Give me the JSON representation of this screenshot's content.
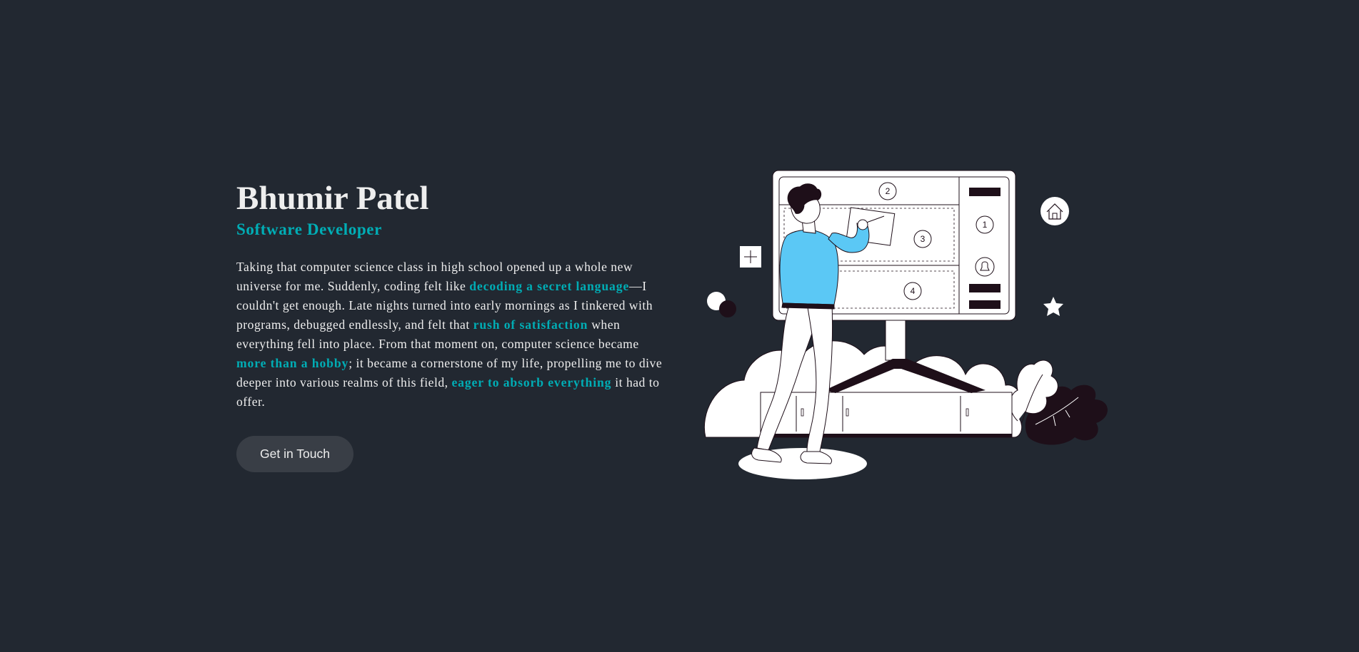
{
  "profile": {
    "name": "Bhumir Patel",
    "role": "Software Developer"
  },
  "bio": {
    "p1": "Taking that computer science class in high school opened up a whole new universe for me. Suddenly, coding felt like ",
    "h1": "decoding a secret language",
    "p2": "—I couldn't get enough. Late nights turned into early mornings as I tinkered with programs, debugged endlessly, and felt that ",
    "h2": "rush of satisfaction",
    "p3": " when everything fell into place. From that moment on, computer science became ",
    "h3": "more than a hobby",
    "p4": "; it became a cornerstone of my life, propelling me to dive deeper into various realms of this field, ",
    "h4": "eager to absorb everything",
    "p5": " it had to offer."
  },
  "cta": {
    "label": "Get in Touch"
  },
  "illustration": {
    "panel_numbers": [
      "1",
      "2",
      "3",
      "4"
    ],
    "icons": [
      "home-icon",
      "bell-icon",
      "plus-icon",
      "star-icon"
    ]
  },
  "colors": {
    "background": "#222831",
    "button": "#393e46",
    "accent": "#00adb5",
    "text": "#eeeeee",
    "figure_shirt": "#5bc8f5",
    "dark_accent": "#1e0f19"
  }
}
